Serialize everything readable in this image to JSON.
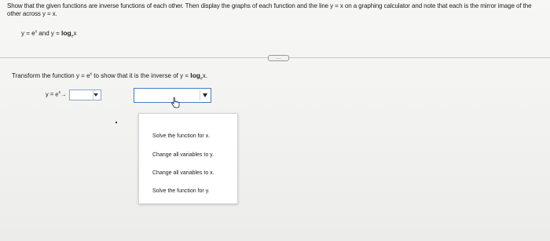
{
  "question": {
    "instruction": "Show that the given functions are inverse functions of each other. Then display the graphs of each function and the line y = x on a graphing calculator and note that each is the mirror image of the other across y = x.",
    "functions": {
      "f1_prefix": "y = e",
      "f1_exp": "x",
      "connector": " and y = ",
      "log": "log",
      "log_base": "e",
      "log_arg": "x"
    }
  },
  "more_button": {
    "label": "....."
  },
  "transform": {
    "prefix": "Transform the function y = e",
    "exp": "x",
    "middle": " to show that it is the inverse of y = ",
    "log": "log",
    "log_base": "e",
    "log_arg": "x."
  },
  "step": {
    "prefix": "y = e",
    "exp": "x",
    "arrow": "→"
  },
  "dropdown_menu": {
    "options": [
      "Solve the function for x.",
      "Change all variables to y.",
      "Change all variables to x.",
      "Solve the function for y."
    ]
  },
  "icons": {
    "dropdown_arrow": "caret-down-icon",
    "cursor": "hand-pointer-icon"
  },
  "colors": {
    "focus_border": "#4a7cc2",
    "dropdown_border": "#8aa4c8"
  }
}
